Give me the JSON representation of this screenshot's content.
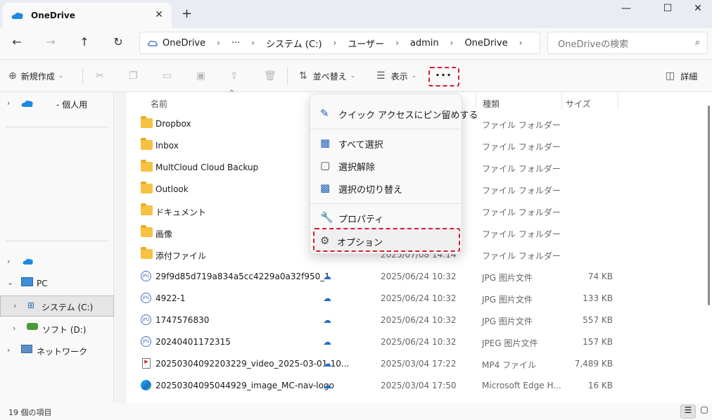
{
  "window": {
    "tab_title": "OneDrive",
    "tab_close": "✕",
    "new_tab": "+",
    "minimize": "—",
    "maximize": "☐",
    "close": "✕"
  },
  "nav": {
    "back": "←",
    "forward": "→",
    "up": "↑",
    "refresh": "↻"
  },
  "address": {
    "items": [
      "OneDrive",
      "···",
      "システム (C:)",
      "ユーザー",
      "admin",
      "OneDrive"
    ],
    "separator": "›"
  },
  "search": {
    "placeholder": "OneDriveの検索",
    "icon": "⌕"
  },
  "toolbar": {
    "new_label": "新規作成",
    "sort_label": "並べ替え",
    "view_label": "表示",
    "more_label": "···",
    "details_label": "詳細"
  },
  "sidebar": {
    "items": [
      {
        "label": "- 個人用"
      },
      {
        "label": ""
      },
      {
        "label": "PC"
      },
      {
        "label": "システム (C:)"
      },
      {
        "label": "ソフト (D:)"
      },
      {
        "label": "ネットワーク"
      }
    ]
  },
  "columns": {
    "name": "名前",
    "type": "種類",
    "size": "サイズ"
  },
  "files": [
    {
      "name": "Dropbox",
      "date": "",
      "type": "ファイル フォルダー",
      "size": "",
      "kind": "folder"
    },
    {
      "name": "Inbox",
      "date": "",
      "type": "ファイル フォルダー",
      "size": "",
      "kind": "folder"
    },
    {
      "name": "MultCloud Cloud Backup",
      "date": "",
      "type": "ファイル フォルダー",
      "size": "",
      "kind": "folder"
    },
    {
      "name": "Outlook",
      "date": "",
      "type": "ファイル フォルダー",
      "size": "",
      "kind": "folder"
    },
    {
      "name": "ドキュメント",
      "date": "",
      "type": "ファイル フォルダー",
      "size": "",
      "kind": "folder"
    },
    {
      "name": "画像",
      "date": "",
      "type": "ファイル フォルダー",
      "size": "",
      "kind": "folder"
    },
    {
      "name": "添付ファイル",
      "date": "2025/07/08 14:14",
      "type": "ファイル フォルダー",
      "size": "",
      "kind": "folder"
    },
    {
      "name": "29f9d85d719a834a5cc4229a0a32f950_1",
      "date": "2025/06/24 10:32",
      "type": "JPG 图片文件",
      "size": "74 KB",
      "kind": "jpg"
    },
    {
      "name": "4922-1",
      "date": "2025/06/24 10:32",
      "type": "JPG 图片文件",
      "size": "133 KB",
      "kind": "jpg"
    },
    {
      "name": "1747576830",
      "date": "2025/06/24 10:32",
      "type": "JPG 图片文件",
      "size": "557 KB",
      "kind": "jpg"
    },
    {
      "name": "20240401172315",
      "date": "2025/06/24 10:32",
      "type": "JPEG 图片文件",
      "size": "157 KB",
      "kind": "jpg"
    },
    {
      "name": "20250304092203229_video_2025-03-01-10...",
      "date": "2025/03/04 17:22",
      "type": "MP4 ファイル",
      "size": "7,489 KB",
      "kind": "mp4"
    },
    {
      "name": "20250304095044929_image_MC-nav-logo",
      "date": "2025/03/04 17:50",
      "type": "Microsoft Edge H...",
      "size": "16 KB",
      "kind": "edge"
    }
  ],
  "menu": {
    "pin": "クイック アクセスにピン留めする",
    "select_all": "すべて選択",
    "select_none": "選択解除",
    "invert": "選択の切り替え",
    "properties": "プロパティ",
    "options": "オプション"
  },
  "status": {
    "count": "19 個の項目"
  },
  "colors": {
    "highlight_border": "#d81b2a",
    "accent": "#1d5fb5"
  }
}
